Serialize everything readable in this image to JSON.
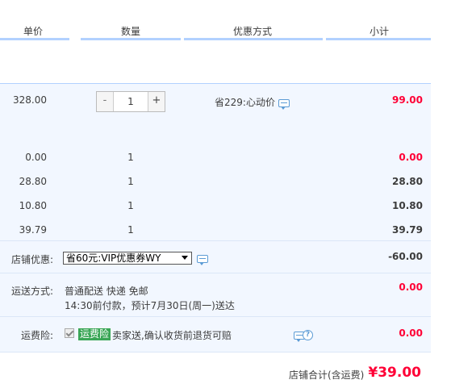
{
  "header": {
    "col_price": "单价",
    "col_qty": "数量",
    "col_promo": "优惠方式",
    "col_subtotal": "小计"
  },
  "main_item": {
    "price": "328.00",
    "qty_minus": "-",
    "quantity": "1",
    "qty_plus": "+",
    "promo": "省229:心动价",
    "subtotal": "99.00"
  },
  "gift_items": [
    {
      "price": "0.00",
      "quantity": "1",
      "subtotal": "0.00"
    },
    {
      "price": "28.80",
      "quantity": "1",
      "subtotal": "28.80"
    },
    {
      "price": "10.80",
      "quantity": "1",
      "subtotal": "10.80"
    },
    {
      "price": "39.79",
      "quantity": "1",
      "subtotal": "39.79"
    }
  ],
  "shop_discount": {
    "label": "店铺优惠:",
    "selected": "省60元:VIP优惠券WY",
    "value": "-60.00"
  },
  "shipping": {
    "label": "运送方式:",
    "method": "普通配送 快递 免邮",
    "note": "14:30前付款，预计7月30日(周一)送达",
    "value": "0.00"
  },
  "insurance": {
    "label": "运费险:",
    "tag": "运费险",
    "text": "卖家送,确认收货前退货可赔",
    "help": "?",
    "value": "0.00"
  },
  "total": {
    "label": "店铺合计(含运费)",
    "value": "¥39.00"
  },
  "colors": {
    "accent_red": "#ff0036",
    "row_bg": "#f2f7ff",
    "header_underline": "#b2d1ff",
    "insurance_green": "#3aa656"
  },
  "icons": [
    "chat-icon",
    "help-icon",
    "dropdown-arrow-icon",
    "checkbox-check-icon"
  ]
}
